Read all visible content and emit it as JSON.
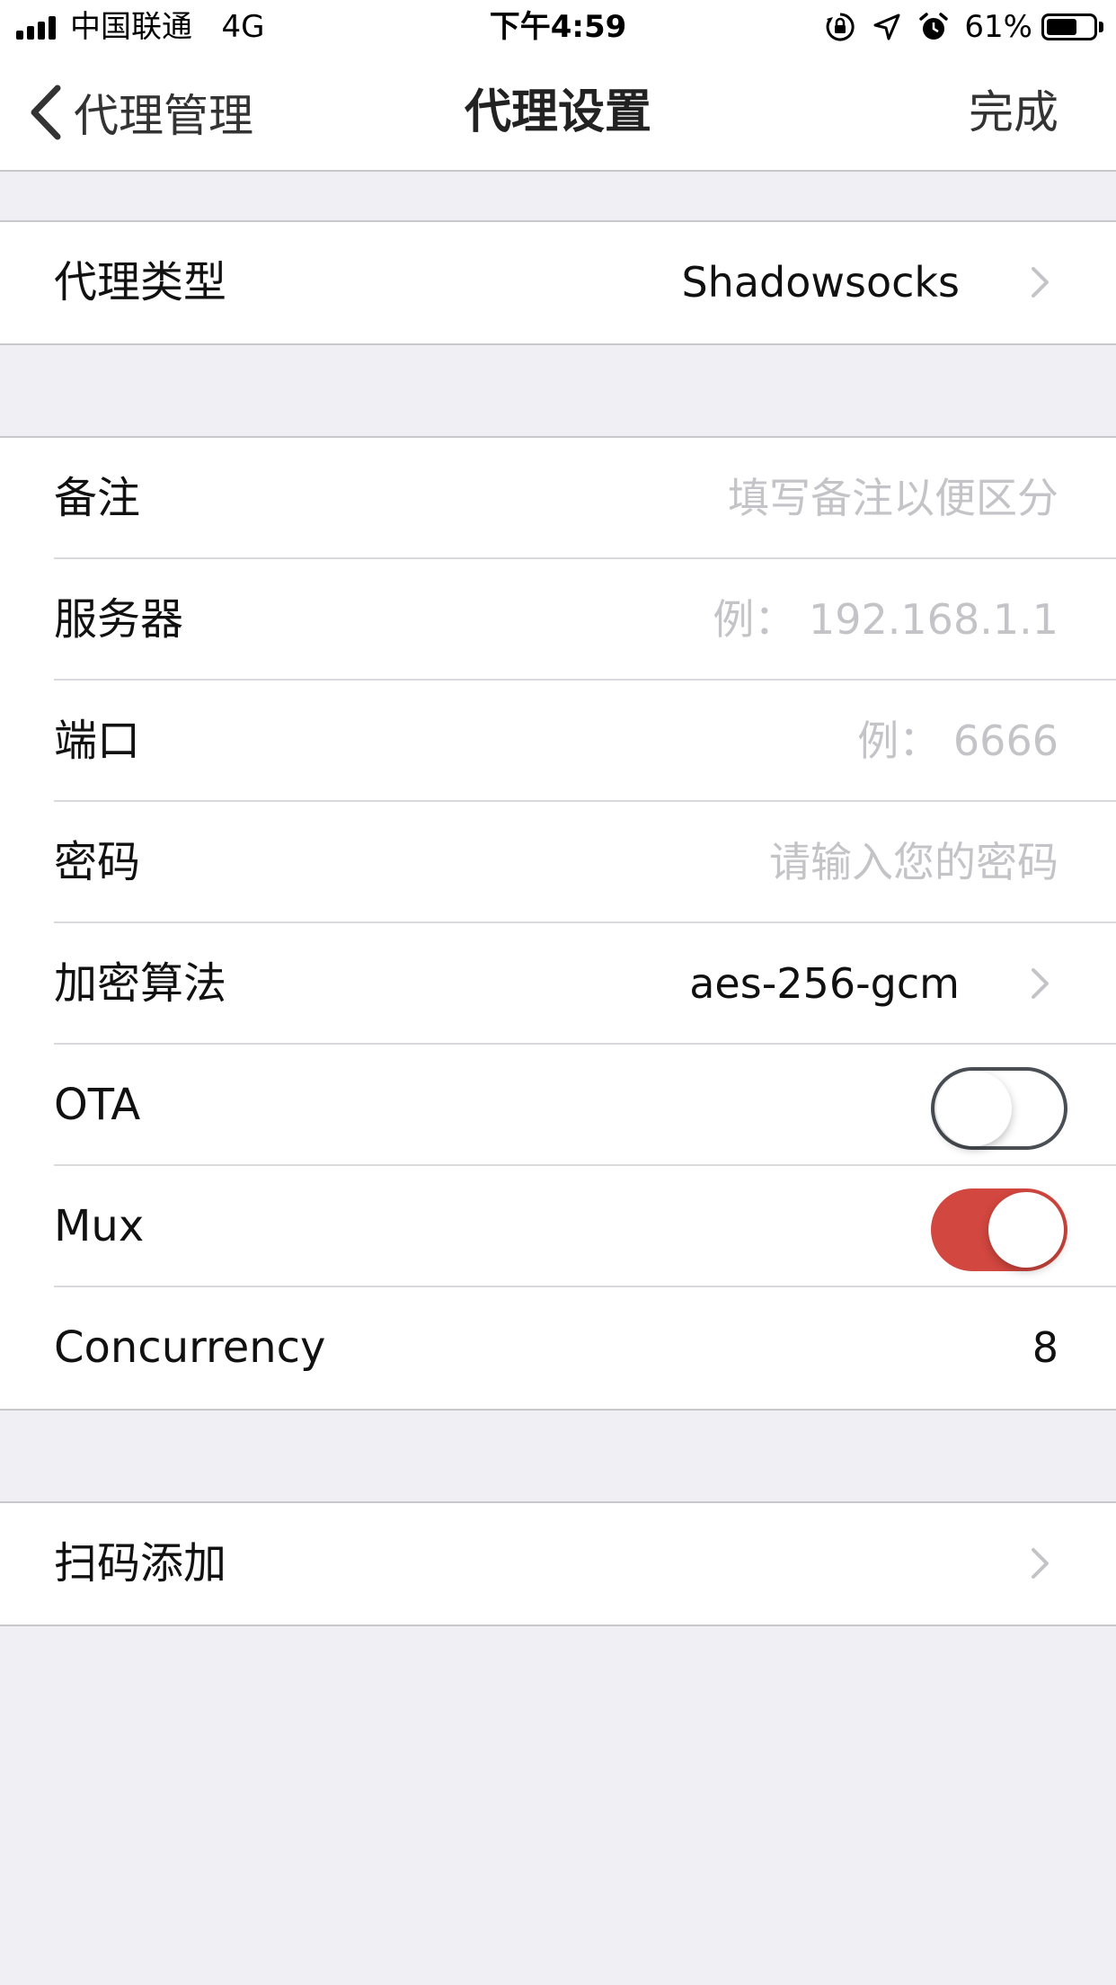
{
  "status_bar": {
    "carrier": "中国联通",
    "network": "4G",
    "time": "下午4:59",
    "battery": "61%",
    "battery_level": 0.61,
    "icons": [
      "orientation-lock-icon",
      "location-icon",
      "alarm-icon"
    ]
  },
  "nav": {
    "back_label": "代理管理",
    "title": "代理设置",
    "done_label": "完成"
  },
  "proxy_type": {
    "label": "代理类型",
    "value": "Shadowsocks"
  },
  "fields": {
    "remark": {
      "label": "备注",
      "placeholder": "填写备注以便区分"
    },
    "server": {
      "label": "服务器",
      "placeholder": "例： 192.168.1.1"
    },
    "port": {
      "label": "端口",
      "placeholder": "例： 6666"
    },
    "password": {
      "label": "密码",
      "placeholder": "请输入您的密码"
    },
    "cipher": {
      "label": "加密算法",
      "value": "aes-256-gcm"
    },
    "ota": {
      "label": "OTA",
      "enabled": false
    },
    "mux": {
      "label": "Mux",
      "enabled": true
    },
    "concurrency": {
      "label": "Concurrency",
      "value": "8"
    }
  },
  "scan": {
    "label": "扫码添加"
  },
  "colors": {
    "accent_toggle_on": "#d2473f",
    "background": "#efeff4",
    "placeholder": "#c4c4c8"
  }
}
